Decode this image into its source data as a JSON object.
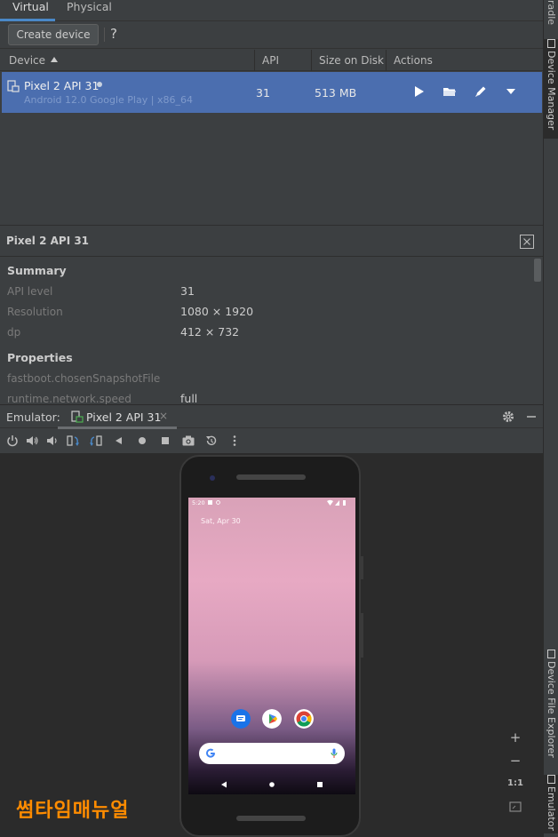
{
  "tabs": [
    {
      "label": "Virtual"
    },
    {
      "label": "Physical"
    }
  ],
  "toolbar": {
    "create_label": "Create device",
    "help_label": "?"
  },
  "table": {
    "headers": {
      "device": "Device",
      "api": "API",
      "size": "Size on Disk",
      "actions": "Actions"
    },
    "rows": [
      {
        "name": "Pixel 2 API 31",
        "subtitle": "Android 12.0 Google Play | x86_64",
        "api": "31",
        "size": "513 MB"
      }
    ]
  },
  "details": {
    "title": "Pixel 2 API 31",
    "summary_label": "Summary",
    "summary": [
      {
        "key": "API level",
        "value": "31"
      },
      {
        "key": "Resolution",
        "value": "1080 × 1920"
      },
      {
        "key": "dp",
        "value": "412 × 732"
      }
    ],
    "properties_label": "Properties",
    "properties": [
      {
        "key": "fastboot.chosenSnapshotFile",
        "value": ""
      },
      {
        "key": "runtime.network.speed",
        "value": "full"
      }
    ]
  },
  "emulator": {
    "label": "Emulator:",
    "tab_label": "Pixel 2 API 31",
    "tab_close": "×",
    "phone": {
      "time": "5:20",
      "date": "Sat, Apr 30"
    },
    "zoom": {
      "in": "+",
      "out": "−",
      "reset": "1:1"
    }
  },
  "right_strip": {
    "top_fragment": "radle",
    "device_manager": "Device Manager",
    "device_file_explorer": "Device File Explorer",
    "emulator": "Emulator"
  },
  "watermark": "썸타임매뉴얼",
  "colors": {
    "selection": "#4b6eaf",
    "panel": "#3c3f41",
    "background": "#2b2b2b",
    "tab_accent": "#4a88c7",
    "watermark": "#ff8c00"
  }
}
